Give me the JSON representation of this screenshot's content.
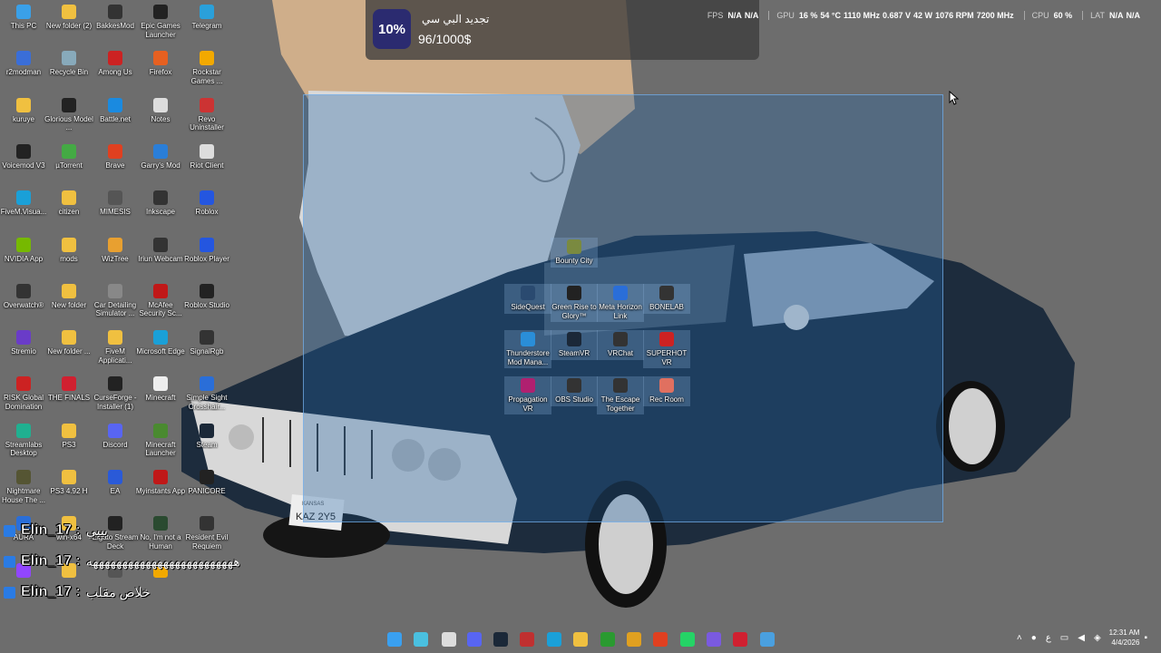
{
  "colors": {
    "selection": "#2264a8",
    "notif_badge": "#2b2b70"
  },
  "notification": {
    "percent": "10%",
    "title": "تجديد البي سي",
    "amount": "96/1000$"
  },
  "osd": [
    {
      "k": "FPS",
      "v": [
        "N/A",
        "N/A"
      ]
    },
    {
      "k": "GPU",
      "v": [
        "16 %",
        "54 °C",
        "1110 MHz",
        "0.687 V",
        "42 W",
        "1076 RPM",
        "7200 MHz"
      ]
    },
    {
      "k": "CPU",
      "v": [
        "60 %"
      ]
    },
    {
      "k": "LAT",
      "v": [
        "N/A",
        "N/A"
      ]
    }
  ],
  "desktop_icons": [
    {
      "label": "This PC",
      "icon": "monitor-icon",
      "color": "#3aa0e8"
    },
    {
      "label": "New folder (2)",
      "icon": "folder-icon",
      "color": "#f0c040"
    },
    {
      "label": "BakkesMod",
      "icon": "bakkesmod-icon",
      "color": "#333"
    },
    {
      "label": "Epic Games Launcher",
      "icon": "epic-icon",
      "color": "#222"
    },
    {
      "label": "Telegram",
      "icon": "telegram-icon",
      "color": "#2aa0da"
    },
    {
      "label": "r2modman",
      "icon": "r2modman-icon",
      "color": "#3a6ed8"
    },
    {
      "label": "Recycle Bin",
      "icon": "recycle-bin-icon",
      "color": "#8ab"
    },
    {
      "label": "Among Us",
      "icon": "among-us-icon",
      "color": "#c22"
    },
    {
      "label": "Firefox",
      "icon": "firefox-icon",
      "color": "#e66020"
    },
    {
      "label": "Rockstar Games ...",
      "icon": "rockstar-icon",
      "color": "#f2a900"
    },
    {
      "label": "kuruye",
      "icon": "folder-icon",
      "color": "#f0c040"
    },
    {
      "label": "Glorious Model ...",
      "icon": "glorious-icon",
      "color": "#222"
    },
    {
      "label": "Battle.net",
      "icon": "battlenet-icon",
      "color": "#1a8ae0"
    },
    {
      "label": "Notes",
      "icon": "notes-icon",
      "color": "#ddd"
    },
    {
      "label": "Revo Uninstaller",
      "icon": "revo-icon",
      "color": "#c33"
    },
    {
      "label": "Voicemod V3",
      "icon": "voicemod-icon",
      "color": "#222"
    },
    {
      "label": "µTorrent",
      "icon": "utorrent-icon",
      "color": "#4a4"
    },
    {
      "label": "Brave",
      "icon": "brave-icon",
      "color": "#e04020"
    },
    {
      "label": "Garry's Mod",
      "icon": "gmod-icon",
      "color": "#2a7ed8"
    },
    {
      "label": "Riot Client",
      "icon": "riot-icon",
      "color": "#ddd"
    },
    {
      "label": "FiveM.Visua...",
      "icon": "edge-icon",
      "color": "#1aa0d8"
    },
    {
      "label": "citizen",
      "icon": "folder-icon",
      "color": "#f0c040"
    },
    {
      "label": "MIMESIS",
      "icon": "mimesis-icon",
      "color": "#555"
    },
    {
      "label": "Inkscape",
      "icon": "inkscape-icon",
      "color": "#333"
    },
    {
      "label": "Roblox",
      "icon": "roblox-icon",
      "color": "#2456e0"
    },
    {
      "label": "NVIDIA App",
      "icon": "nvidia-icon",
      "color": "#76b900"
    },
    {
      "label": "mods",
      "icon": "folder-icon",
      "color": "#f0c040"
    },
    {
      "label": "WizTree",
      "icon": "wiztree-icon",
      "color": "#e8a030"
    },
    {
      "label": "Iriun Webcam",
      "icon": "iriun-icon",
      "color": "#333"
    },
    {
      "label": "Roblox Player",
      "icon": "roblox-icon",
      "color": "#2456e0"
    },
    {
      "label": "Overwatch®",
      "icon": "overwatch-icon",
      "color": "#333"
    },
    {
      "label": "New folder",
      "icon": "folder-icon",
      "color": "#f0c040"
    },
    {
      "label": "Car Detailing Simulator ...",
      "icon": "car-detailing-icon",
      "color": "#888"
    },
    {
      "label": "McAfee Security Sc...",
      "icon": "mcafee-icon",
      "color": "#c01818"
    },
    {
      "label": "Roblox Studio",
      "icon": "roblox-studio-icon",
      "color": "#222"
    },
    {
      "label": "Stremio",
      "icon": "stremio-icon",
      "color": "#6a3cc8"
    },
    {
      "label": "New folder ...",
      "icon": "folder-icon",
      "color": "#f0c040"
    },
    {
      "label": "FiveM Applicati...",
      "icon": "folder-icon",
      "color": "#f0c040"
    },
    {
      "label": "Microsoft Edge",
      "icon": "edge-icon",
      "color": "#1aa0d8"
    },
    {
      "label": "SignalRgb",
      "icon": "signalrgb-icon",
      "color": "#333"
    },
    {
      "label": "RISK Global Domination",
      "icon": "risk-icon",
      "color": "#c22"
    },
    {
      "label": "THE FINALS",
      "icon": "the-finals-icon",
      "color": "#d02030"
    },
    {
      "label": "CurseForge - Installer (1)",
      "icon": "curseforge-icon",
      "color": "#222"
    },
    {
      "label": "Minecraft",
      "icon": "file-icon",
      "color": "#eee"
    },
    {
      "label": "Simple Sight Crosshair...",
      "icon": "crosshair-icon",
      "color": "#2a6ed8"
    },
    {
      "label": "Streamlabs Desktop",
      "icon": "streamlabs-icon",
      "color": "#20b090"
    },
    {
      "label": "PS3",
      "icon": "folder-icon",
      "color": "#f0c040"
    },
    {
      "label": "Discord",
      "icon": "discord-icon",
      "color": "#5865f2"
    },
    {
      "label": "Minecraft Launcher",
      "icon": "minecraft-icon",
      "color": "#4a8a30"
    },
    {
      "label": "Steam",
      "icon": "steam-icon",
      "color": "#1b2838"
    },
    {
      "label": "Nightmare House The ...",
      "icon": "nightmare-house-icon",
      "color": "#553"
    },
    {
      "label": "PS3 4.92 H",
      "icon": "folder-icon",
      "color": "#f0c040"
    },
    {
      "label": "EA",
      "icon": "ea-icon",
      "color": "#2a5ad8"
    },
    {
      "label": "Myinstants App",
      "icon": "myinstants-icon",
      "color": "#c01818"
    },
    {
      "label": "PANICORE",
      "icon": "panicore-icon",
      "color": "#222"
    },
    {
      "label": "AURA",
      "icon": "aura-icon",
      "color": "#2a6ed8"
    },
    {
      "label": "win-x64",
      "icon": "folder-icon",
      "color": "#f0c040"
    },
    {
      "label": "Elgato Stream Deck",
      "icon": "elgato-icon",
      "color": "#222"
    },
    {
      "label": "No, I'm not a Human",
      "icon": "no-human-icon",
      "color": "#2a4a30"
    },
    {
      "label": "Resident Evil Requiem",
      "icon": "resident-evil-icon",
      "color": "#333"
    },
    {
      "label": "",
      "icon": "twitch-icon",
      "color": "#9146ff"
    },
    {
      "label": "",
      "icon": "folder-icon",
      "color": "#f0c040"
    },
    {
      "label": "",
      "icon": "app-icon",
      "color": "#555"
    },
    {
      "label": "",
      "icon": "rockstar-icon",
      "color": "#f2a900"
    }
  ],
  "selected_icons": [
    {
      "label": "Bounty City",
      "icon": "bounty-city-icon",
      "color": "#7a8a40"
    },
    {
      "label": "SideQuest",
      "icon": "sidequest-icon",
      "color": "#2a4a70"
    },
    {
      "label": "Green Rise to Glory™",
      "icon": "green-rise-icon",
      "color": "#222"
    },
    {
      "label": "Meta Horizon Link",
      "icon": "meta-icon",
      "color": "#2a6ed8"
    },
    {
      "label": "BONELAB",
      "icon": "bonelab-icon",
      "color": "#333"
    },
    {
      "label": "Thunderstore Mod Mana...",
      "icon": "thunderstore-icon",
      "color": "#2a8ed8"
    },
    {
      "label": "SteamVR",
      "icon": "steamvr-icon",
      "color": "#1b2838"
    },
    {
      "label": "VRChat",
      "icon": "vrchat-icon",
      "color": "#333"
    },
    {
      "label": "SUPERHOT VR",
      "icon": "superhot-icon",
      "color": "#c22"
    },
    {
      "label": "Propagation VR",
      "icon": "propagation-icon",
      "color": "#b02070"
    },
    {
      "label": "OBS Studio",
      "icon": "obs-icon",
      "color": "#333"
    },
    {
      "label": "The Escape Together",
      "icon": "escape-together-icon",
      "color": "#333"
    },
    {
      "label": "Rec Room",
      "icon": "rec-room-icon",
      "color": "#e07060"
    }
  ],
  "plate": "KAZ 2Y5",
  "plate_state": "KANSAS",
  "chat": [
    {
      "user": "Elin_17 :",
      "msg": "بيبي"
    },
    {
      "user": "Elin_17 :",
      "msg": "هههههههههههههههههههههههههه"
    },
    {
      "user": "Elin_17 :",
      "msg": "خلاص مقلب"
    }
  ],
  "taskbar_icons": [
    {
      "icon": "windows-start-icon",
      "color": "#3aa0f0"
    },
    {
      "icon": "search-icon",
      "color": "#4ac0e0"
    },
    {
      "icon": "file-explorer-icon",
      "color": "#ddd"
    },
    {
      "icon": "discord-icon",
      "color": "#5865f2"
    },
    {
      "icon": "steam-icon",
      "color": "#1b2838"
    },
    {
      "icon": "app-icon",
      "color": "#c03030"
    },
    {
      "icon": "edge-icon",
      "color": "#1aa0d8"
    },
    {
      "icon": "folder-icon",
      "color": "#f0c040"
    },
    {
      "icon": "xbox-icon",
      "color": "#2a9a30"
    },
    {
      "icon": "chrome-icon",
      "color": "#e0a020"
    },
    {
      "icon": "brave-icon",
      "color": "#e04020"
    },
    {
      "icon": "whatsapp-icon",
      "color": "#25d366"
    },
    {
      "icon": "apps-grid-icon",
      "color": "#7a5ae0"
    },
    {
      "icon": "adobe-icon",
      "color": "#d02030"
    },
    {
      "icon": "app-icon",
      "color": "#4aa0e0"
    }
  ],
  "tray": {
    "ime": "ع",
    "time": "12:31 AM",
    "date": "4/4/2026"
  }
}
